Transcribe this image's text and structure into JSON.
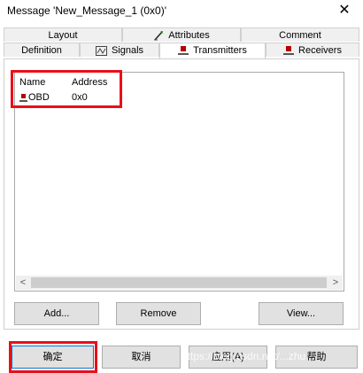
{
  "window": {
    "title": "Message 'New_Message_1 (0x0)'",
    "close_glyph": "✕"
  },
  "tabs_row1": [
    {
      "label": "Layout",
      "icon": null
    },
    {
      "label": "Attributes",
      "icon": "attributes-icon"
    },
    {
      "label": "Comment",
      "icon": null
    }
  ],
  "tabs_row2": [
    {
      "label": "Definition",
      "icon": null
    },
    {
      "label": "Signals",
      "icon": "signals-icon"
    },
    {
      "label": "Transmitters",
      "icon": "transmitter-node-icon",
      "active": true
    },
    {
      "label": "Receivers",
      "icon": "receiver-node-icon"
    }
  ],
  "transmitters": {
    "columns": [
      "Name",
      "Address"
    ],
    "rows": [
      {
        "name": "OBD",
        "address": "0x0",
        "icon": "node-icon"
      }
    ]
  },
  "scrollbar": {
    "left_glyph": "<",
    "right_glyph": ">"
  },
  "panel_buttons": {
    "add": "Add...",
    "remove": "Remove",
    "view": "View..."
  },
  "dialog_buttons": {
    "ok": "确定",
    "cancel": "取消",
    "apply": "应用(A)",
    "help": "帮助"
  },
  "watermark": "https://blog.csdn.net/...zhu",
  "colors": {
    "highlight": "#e8101a",
    "node_icon": "#b40000"
  }
}
